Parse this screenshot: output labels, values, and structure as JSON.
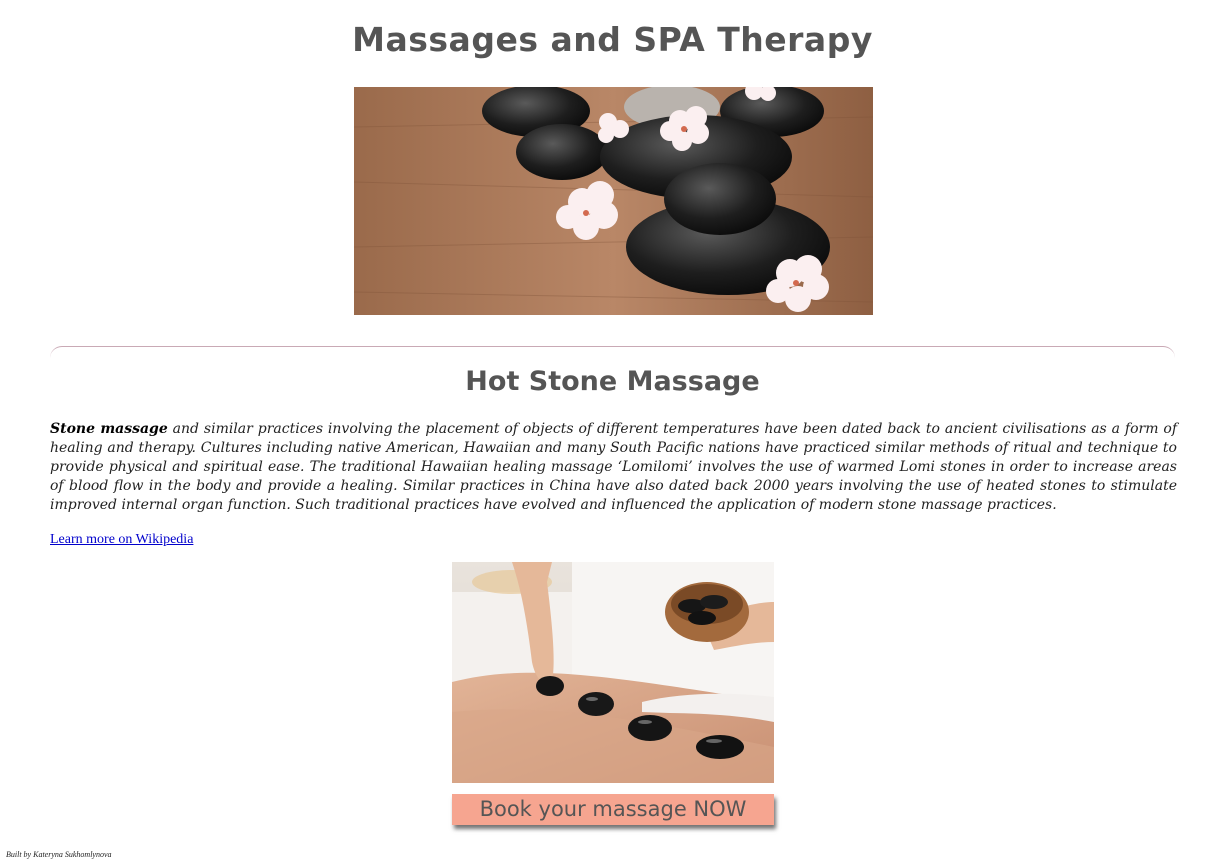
{
  "header": {
    "title": "Massages and SPA Therapy"
  },
  "hero": {
    "image": "hot-stones-with-blossoms-image"
  },
  "section": {
    "title": "Hot Stone Massage",
    "lead_bold": "Stone massage",
    "body": " and similar practices involving the placement of objects of different temperatures have been dated back to ancient civilisations as a form of healing and therapy. Cultures including native American, Hawaiian and many South Pacific nations have practiced similar methods of ritual and technique to provide physical and spiritual ease. The traditional Hawaiian healing massage ‘Lomilomi’ involves the use of warmed Lomi stones in order to increase areas of blood flow in the body and provide a healing. Similar practices in China have also dated back 2000 years involving the use of heated stones to stimulate improved internal organ function. Such traditional practices have evolved and influenced the application of modern stone massage practices.",
    "link_label": "Learn more on Wikipedia",
    "image": "hot-stone-massage-back-image"
  },
  "cta": {
    "label": "Book your massage NOW",
    "color": "#f6a590"
  },
  "footer": {
    "credit": "Built by Kateryna Sukhomlynova"
  }
}
